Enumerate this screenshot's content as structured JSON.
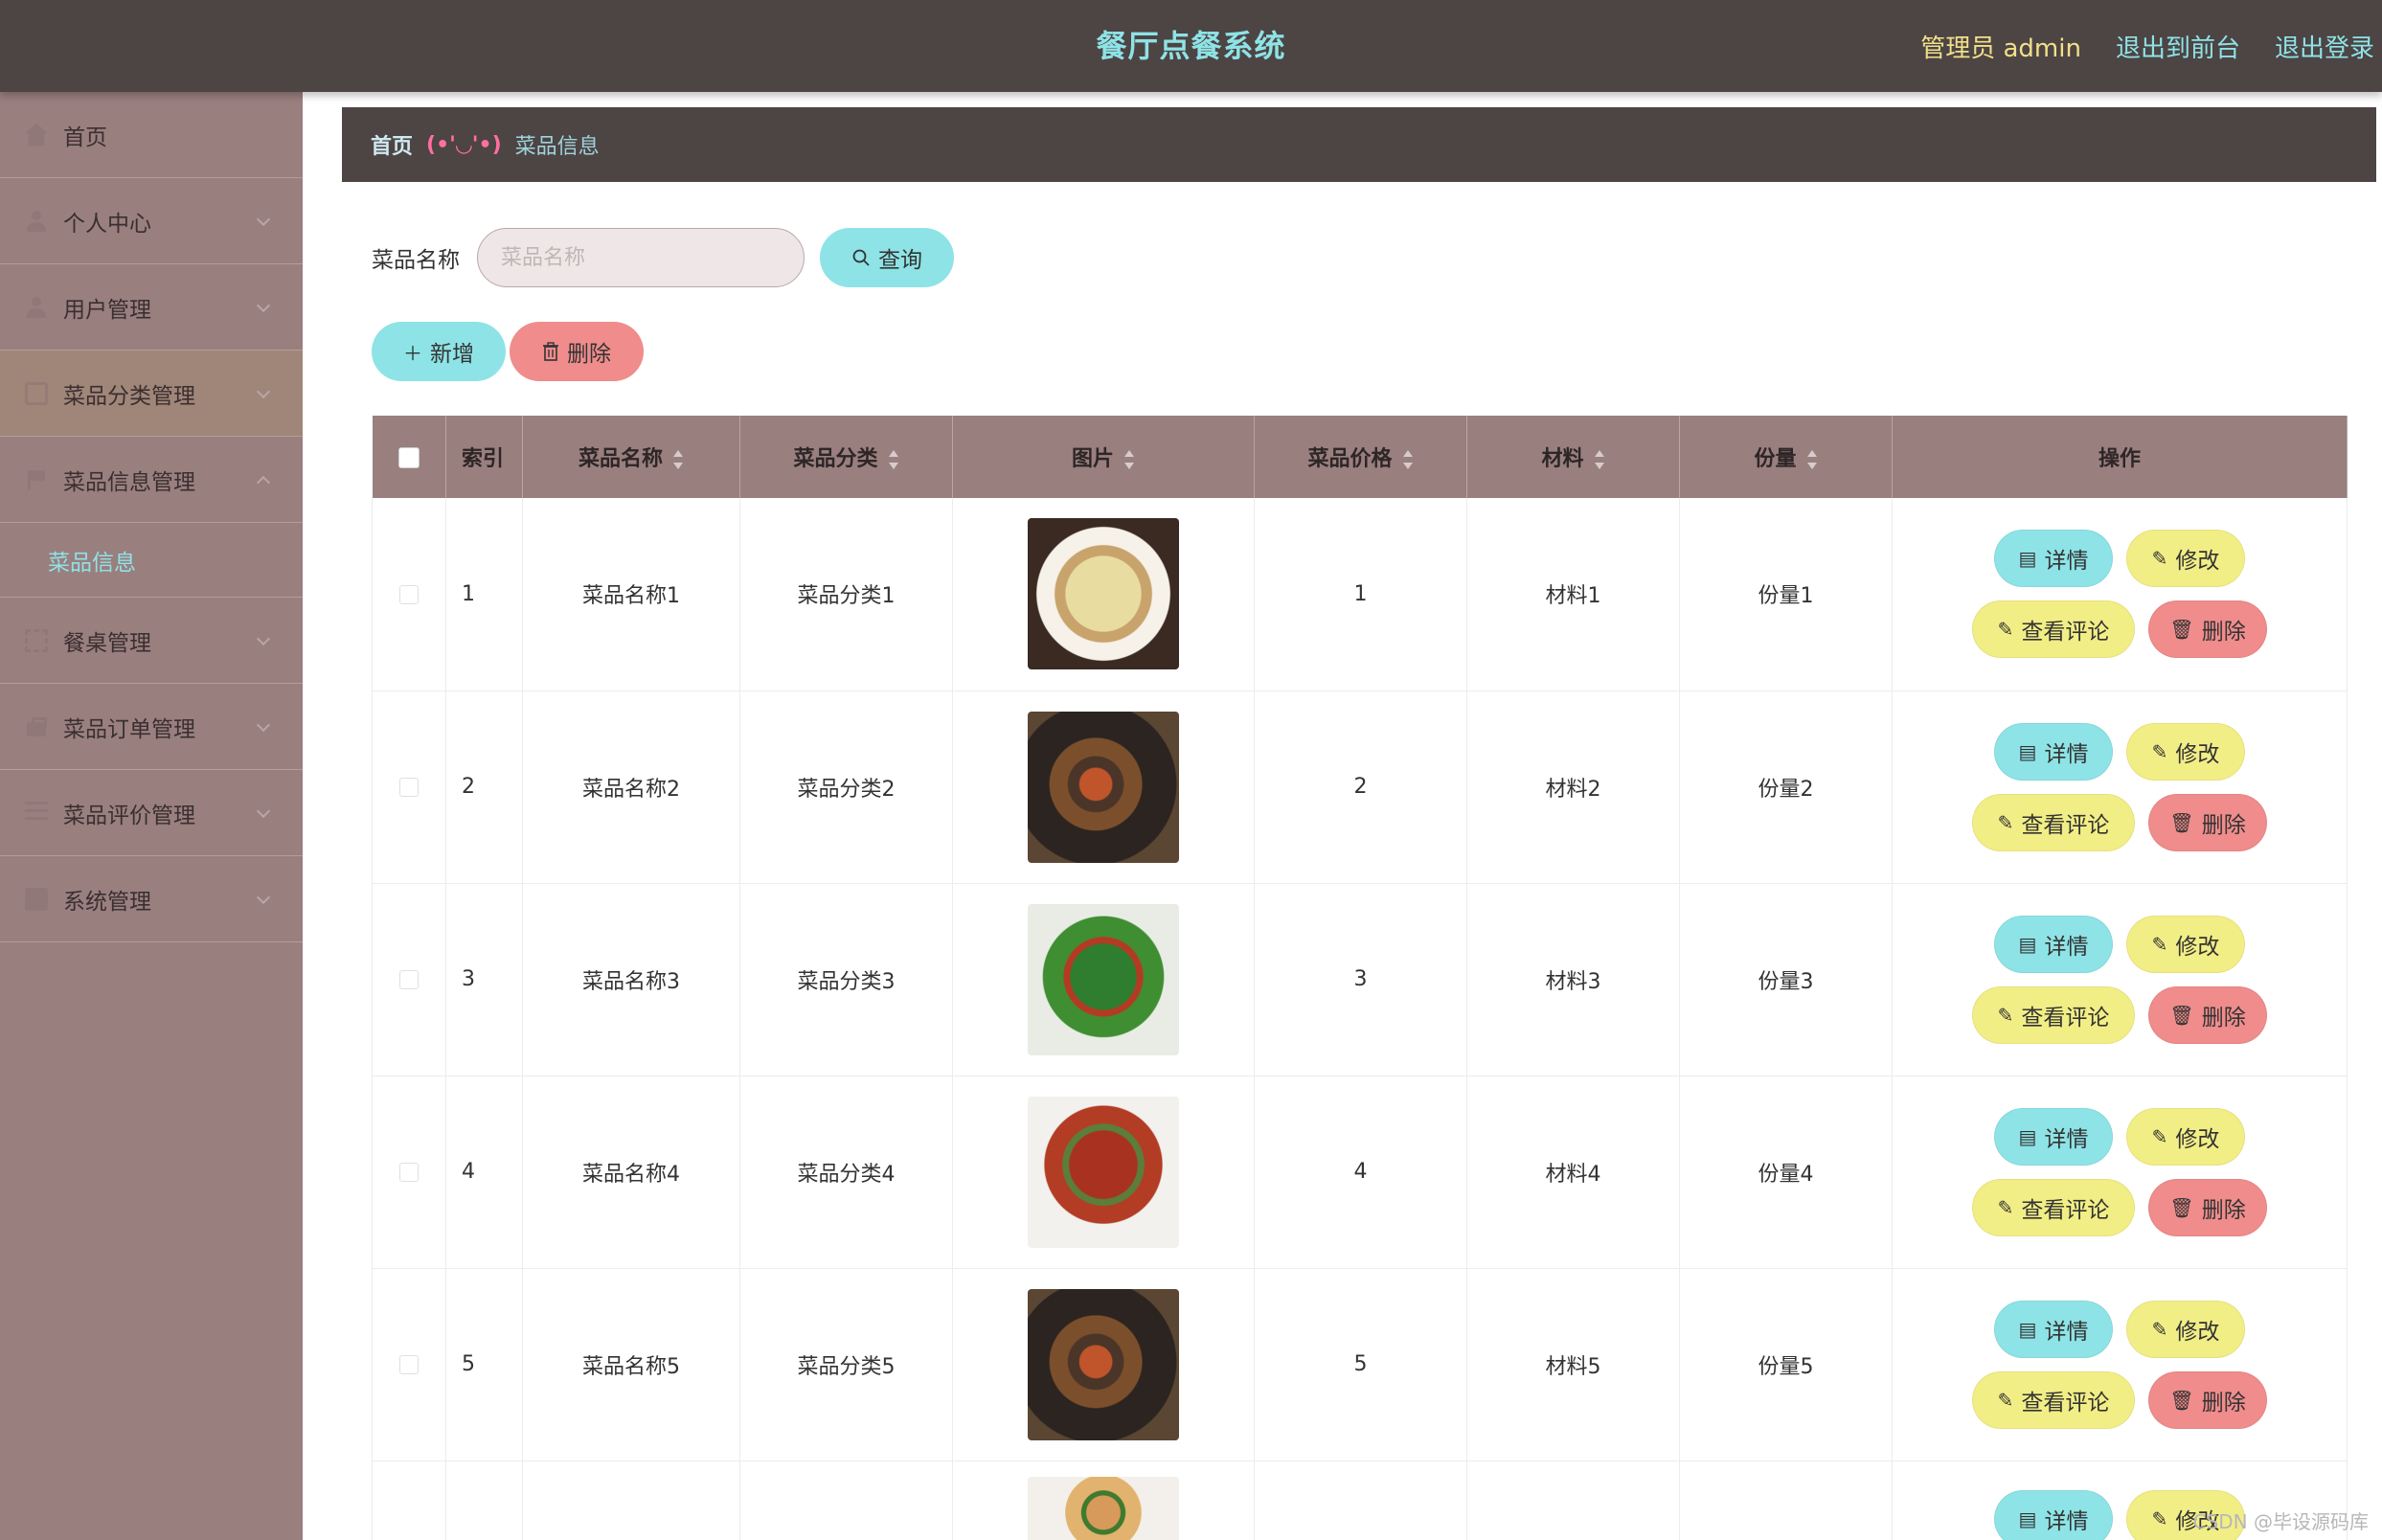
{
  "header": {
    "title": "餐厅点餐系统",
    "admin_label": "管理员 admin",
    "to_front_label": "退出到前台",
    "logout_label": "退出登录"
  },
  "sidebar": {
    "items": [
      {
        "label": "首页",
        "icon": "home-icon"
      },
      {
        "label": "个人中心",
        "icon": "user-icon"
      },
      {
        "label": "用户管理",
        "icon": "user-icon"
      },
      {
        "label": "菜品分类管理",
        "icon": "grid-icon"
      },
      {
        "label": "菜品信息管理",
        "icon": "flag-icon"
      },
      {
        "label": "菜品信息",
        "icon": ""
      },
      {
        "label": "餐桌管理",
        "icon": "table-icon"
      },
      {
        "label": "菜品订单管理",
        "icon": "bag-icon"
      },
      {
        "label": "菜品评价管理",
        "icon": "list-icon"
      },
      {
        "label": "系统管理",
        "icon": "settings-icon"
      }
    ]
  },
  "breadcrumb": {
    "home": "首页",
    "separator": "(•'◡'•)",
    "current": "菜品信息"
  },
  "search": {
    "label": "菜品名称",
    "placeholder": "菜品名称",
    "value": "",
    "query_label": "查询"
  },
  "actions": {
    "add_label": "新增",
    "delete_label": "删除"
  },
  "table": {
    "columns": [
      "索引",
      "菜品名称",
      "菜品分类",
      "图片",
      "菜品价格",
      "材料",
      "份量",
      "操作"
    ],
    "row_buttons": {
      "detail": "详情",
      "edit": "修改",
      "review": "查看评论",
      "delete": "删除"
    },
    "rows": [
      {
        "index": "1",
        "name": "菜品名称1",
        "category": "菜品分类1",
        "price": "1",
        "material": "材料1",
        "portion": "份量1"
      },
      {
        "index": "2",
        "name": "菜品名称2",
        "category": "菜品分类2",
        "price": "2",
        "material": "材料2",
        "portion": "份量2"
      },
      {
        "index": "3",
        "name": "菜品名称3",
        "category": "菜品分类3",
        "price": "3",
        "material": "材料3",
        "portion": "份量3"
      },
      {
        "index": "4",
        "name": "菜品名称4",
        "category": "菜品分类4",
        "price": "4",
        "material": "材料4",
        "portion": "份量4"
      },
      {
        "index": "5",
        "name": "菜品名称5",
        "category": "菜品分类5",
        "price": "5",
        "material": "材料5",
        "portion": "份量5"
      }
    ]
  },
  "watermark": "CSDN @毕设源码库",
  "colors": {
    "header_bg": "#4d4444",
    "sidebar_bg": "#9a7f7f",
    "accent_cyan": "#8ee3e6",
    "accent_yellow": "#f2ee86",
    "accent_red": "#f08c8c"
  }
}
